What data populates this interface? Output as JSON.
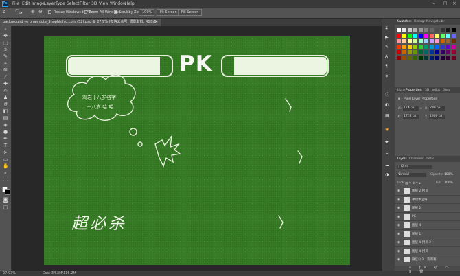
{
  "menubar": {
    "logo": "Ps",
    "items": [
      "File",
      "Edit",
      "Image",
      "Layer",
      "Type",
      "Select",
      "Filter",
      "3D",
      "View",
      "Window",
      "Help"
    ]
  },
  "options": {
    "resize_windows": "Resize Windows to Fit",
    "zoom_all_windows": "Zoom All Windows",
    "scrubby_zoom": "Scrubby Zoom",
    "zoom_value": "100%",
    "fit_screen": "Fit Screen",
    "fill_screen": "Fill Screen"
  },
  "document": {
    "tab_title": "background ve phan cute_Shophinhio.com (52).psd @ 27.9% (微信公众号: 遇影有料, RGB/8)",
    "close": "×"
  },
  "canvas": {
    "pk_text": "PK",
    "bottom_text": "超必杀"
  },
  "status": {
    "zoom": "27.93%",
    "doc_size": "Doc: 34.3M/116.2M"
  },
  "panels": {
    "swatches_tabs": [
      "Swatches",
      "Histogr",
      "Navigat",
      "Libr"
    ],
    "properties_tabs": [
      "Librar",
      "Properties",
      "3D",
      "Adjus",
      "Style"
    ],
    "properties_title": "Pixel Layer Properties",
    "prop_w": "W:",
    "prop_w_val": "126 px",
    "prop_h": "H:",
    "prop_h_val": "299 px",
    "prop_x": "X:",
    "prop_x_val": "1738 px",
    "prop_y": "Y:",
    "prop_y_val": "1900 px",
    "layers_tabs": [
      "Layers",
      "Channels",
      "Paths"
    ],
    "kind": "Kind",
    "blend_mode": "Normal",
    "opacity_label": "Opacity:",
    "opacity": "100%",
    "lock_label": "Lock:",
    "fill_label": "Fill:",
    "fill": "100%",
    "layers": [
      "图层 2 拷贝",
      "半动本运呀",
      "图层 2",
      "PK",
      "图层 4",
      "图层 1",
      "图层 4 拷贝 2",
      "图层 4 拷贝",
      "微信公众...影有料"
    ]
  },
  "colors": {
    "accent": "#31a8ff",
    "canvas_green": "#377a26",
    "ui_panel": "#535353"
  },
  "swatch_colors": [
    "#ffffff",
    "#e6e6e6",
    "#cccccc",
    "#b3b3b3",
    "#999999",
    "#808080",
    "#666666",
    "#4d4d4d",
    "#333333",
    "#1a1a1a",
    "#000000",
    "#ff0000",
    "#ffff00",
    "#00ff00",
    "#00ffff",
    "#0000ff",
    "#ff00ff",
    "#ff6666",
    "#ffff66",
    "#66ff66",
    "#66ffff",
    "#6666ff",
    "#ff9999",
    "#ffcc99",
    "#ffff99",
    "#ccff99",
    "#99ffcc",
    "#99ccff",
    "#cc99ff",
    "#ff99cc",
    "#cc6600",
    "#996633",
    "#663300",
    "#ff3300",
    "#ff9900",
    "#ffcc00",
    "#99cc00",
    "#33cc33",
    "#009966",
    "#0099cc",
    "#0066ff",
    "#3333cc",
    "#6600cc",
    "#cc0099",
    "#cc0000",
    "#cc6600",
    "#999900",
    "#669900",
    "#006633",
    "#006666",
    "#003399",
    "#000099",
    "#330066",
    "#660066",
    "#990033",
    "#990000",
    "#994c00",
    "#666600",
    "#336600",
    "#003300",
    "#003333",
    "#001a66",
    "#000066",
    "#1a0033",
    "#330033",
    "#660022"
  ]
}
